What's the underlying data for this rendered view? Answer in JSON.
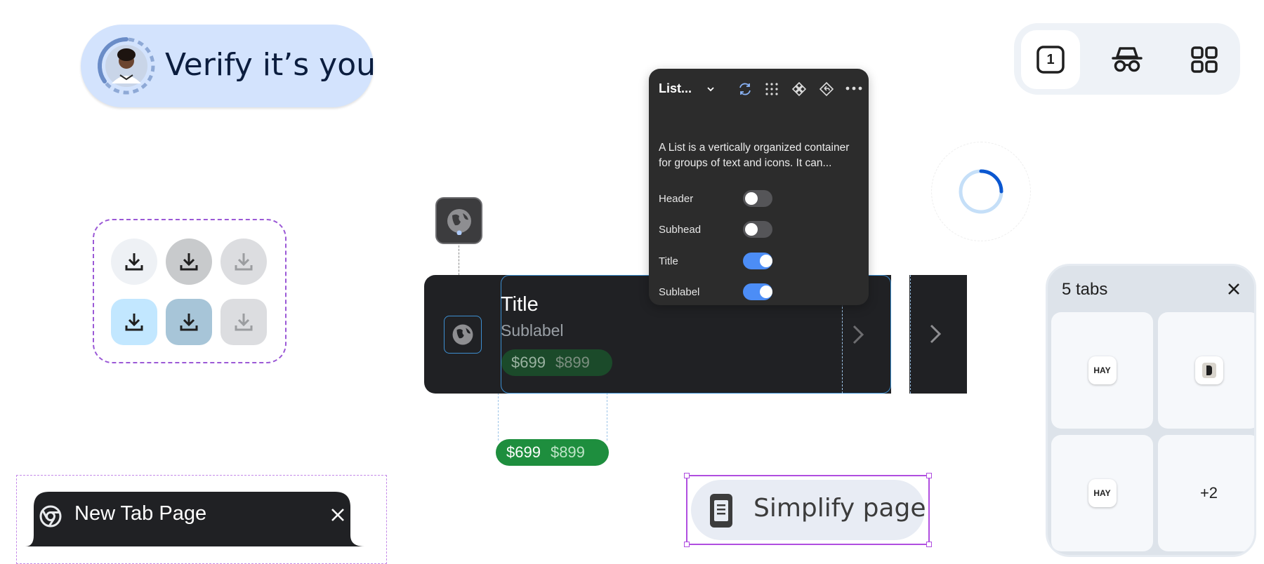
{
  "verify": {
    "title": "Verify it’s you"
  },
  "toolbar": {
    "tab_count": "1"
  },
  "list_item": {
    "title": "Title",
    "sublabel": "Sublabel",
    "price_sale": "$699",
    "price_original": "$899"
  },
  "price_chip": {
    "price_sale": "$699",
    "price_original": "$899"
  },
  "popover": {
    "title": "List...",
    "description": "A List is a vertically organized container for groups of text and icons. It can...",
    "rows": [
      {
        "label": "Header",
        "on": false
      },
      {
        "label": "Subhead",
        "on": false
      },
      {
        "label": "Title",
        "on": true
      },
      {
        "label": "Sublabel",
        "on": true
      }
    ]
  },
  "tab_grid": {
    "title": "5 tabs",
    "tiles": [
      {
        "favicon_text": "HAY"
      },
      {
        "favicon_text": ""
      },
      {
        "favicon_text": "HAY"
      },
      {
        "more": "+2"
      }
    ]
  },
  "ntp_tab": {
    "label": "New Tab Page"
  },
  "simplify": {
    "label": "Simplify page"
  },
  "colors": {
    "accent_blue": "#4c8df6",
    "verify_bg": "#d3e3fd",
    "price_green": "#1e8e3e",
    "selection_purple": "#b04ee0"
  }
}
